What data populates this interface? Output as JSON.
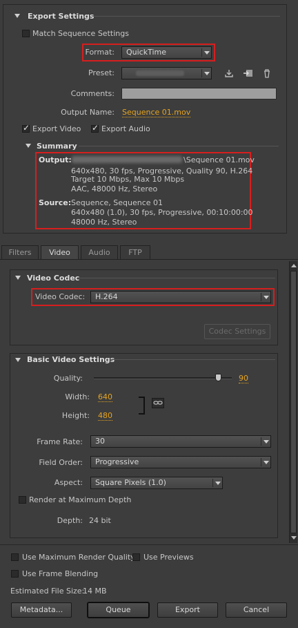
{
  "export_settings": {
    "title": "Export Settings",
    "match_sequence": {
      "label": "Match Sequence Settings",
      "checked": false
    },
    "format": {
      "label": "Format:",
      "value": "QuickTime"
    },
    "preset": {
      "label": "Preset:",
      "value": ""
    },
    "comments": {
      "label": "Comments:",
      "value": ""
    },
    "output_name": {
      "label": "Output Name:",
      "value": "Sequence 01.mov"
    },
    "export_video": {
      "label": "Export Video",
      "checked": true
    },
    "export_audio": {
      "label": "Export Audio",
      "checked": true
    },
    "summary": {
      "title": "Summary",
      "output_label": "Output:",
      "output_lines": [
        "\\Sequence 01.mov",
        "640x480, 30 fps, Progressive, Quality 90, H.264",
        "Target 10 Mbps, Max 10 Mbps",
        "AAC, 48000 Hz, Stereo"
      ],
      "source_label": "Source:",
      "source_lines": [
        "Sequence, Sequence 01",
        "640x480 (1.0), 30 fps, Progressive, 00:10:00:00",
        "48000 Hz, Stereo"
      ]
    }
  },
  "tabs": [
    {
      "label": "Filters",
      "active": false
    },
    {
      "label": "Video",
      "active": true
    },
    {
      "label": "Audio",
      "active": false
    },
    {
      "label": "FTP",
      "active": false
    }
  ],
  "video_codec": {
    "title": "Video Codec",
    "label": "Video Codec:",
    "value": "H.264",
    "codec_settings_button": "Codec Settings"
  },
  "basic_video": {
    "title": "Basic Video Settings",
    "quality": {
      "label": "Quality:",
      "value": "90",
      "fraction": 0.9
    },
    "width": {
      "label": "Width:",
      "value": "640"
    },
    "height": {
      "label": "Height:",
      "value": "480"
    },
    "frame_rate": {
      "label": "Frame Rate:",
      "value": "30"
    },
    "field_order": {
      "label": "Field Order:",
      "value": "Progressive"
    },
    "aspect": {
      "label": "Aspect:",
      "value": "Square Pixels (1.0)"
    },
    "render_max_depth": {
      "label": "Render at Maximum Depth",
      "checked": false
    },
    "depth": {
      "label": "Depth:",
      "value": "24 bit"
    }
  },
  "footer": {
    "max_render_quality": {
      "label": "Use Maximum Render Quality",
      "checked": false
    },
    "use_previews": {
      "label": "Use Previews",
      "checked": false
    },
    "frame_blending": {
      "label": "Use Frame Blending",
      "checked": false
    },
    "file_size_label": "Estimated File Size:",
    "file_size_value": "14 MB",
    "buttons": {
      "metadata": "Metadata...",
      "queue": "Queue",
      "export": "Export",
      "cancel": "Cancel"
    }
  },
  "colors": {
    "accent_link": "#e6a420",
    "highlight_box": "#d81e1e",
    "background": "#3c3c3c"
  },
  "icons": [
    "save-preset-icon",
    "import-preset-icon",
    "delete-preset-icon",
    "link-chain-icon"
  ]
}
